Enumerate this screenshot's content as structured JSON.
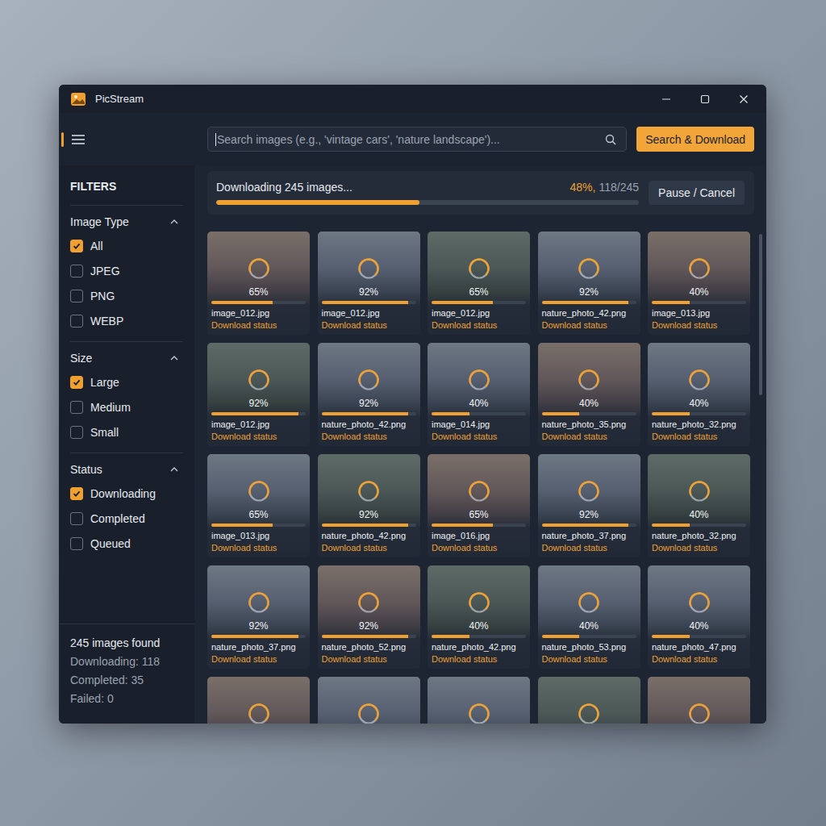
{
  "window": {
    "title": "PicStream"
  },
  "toolbar": {
    "search": {
      "placeholder": "Search images (e.g., 'vintage cars', 'nature landscape')..."
    },
    "button": "Search & Download"
  },
  "sidebar": {
    "title": "FILTERS",
    "groups": [
      {
        "label": "Image Type",
        "expanded": true,
        "options": [
          {
            "label": "All",
            "checked": true
          },
          {
            "label": "JPEG",
            "checked": false
          },
          {
            "label": "PNG",
            "checked": false
          },
          {
            "label": "WEBP",
            "checked": false
          }
        ]
      },
      {
        "label": "Size",
        "expanded": true,
        "options": [
          {
            "label": "Large",
            "checked": true
          },
          {
            "label": "Medium",
            "checked": false
          },
          {
            "label": "Small",
            "checked": false
          }
        ]
      },
      {
        "label": "Status",
        "expanded": true,
        "options": [
          {
            "label": "Downloading",
            "checked": true
          },
          {
            "label": "Completed",
            "checked": false
          },
          {
            "label": "Queued",
            "checked": false
          }
        ]
      }
    ],
    "summary": {
      "found": "245 images found",
      "lines": [
        "Downloading: 118",
        "Completed: 35",
        "Failed: 0"
      ]
    }
  },
  "progress": {
    "title": "Downloading 245 images...",
    "percent": "48%,",
    "count": "118/245",
    "level": 0.48,
    "button": "Pause / Cancel"
  },
  "cards": [
    {
      "kind": "full",
      "name": "image_012.jpg",
      "percent": "65%",
      "level": 0.65,
      "status": "Download status"
    },
    {
      "kind": "full",
      "name": "image_012.jpg",
      "percent": "92%",
      "level": 0.92,
      "status": "Download status"
    },
    {
      "kind": "full",
      "name": "image_012.jpg",
      "percent": "65%",
      "level": 0.65,
      "status": "Download status"
    },
    {
      "kind": "full",
      "name": "nature_photo_42.png",
      "percent": "92%",
      "level": 0.92,
      "status": "Download status"
    },
    {
      "kind": "full",
      "name": "image_013.jpg",
      "percent": "40%",
      "level": 0.4,
      "status": "Download status"
    },
    {
      "kind": "full",
      "name": "image_012.jpg",
      "percent": "92%",
      "level": 0.92,
      "status": "Download status"
    },
    {
      "kind": "full",
      "name": "nature_photo_42.png",
      "percent": "92%",
      "level": 0.92,
      "status": "Download status"
    },
    {
      "kind": "full",
      "name": "image_014.jpg",
      "percent": "40%",
      "level": 0.4,
      "status": "Download status"
    },
    {
      "kind": "full",
      "name": "nature_photo_35.png",
      "percent": "40%",
      "level": 0.4,
      "status": "Download status"
    },
    {
      "kind": "full",
      "name": "nature_photo_32.png",
      "percent": "40%",
      "level": 0.4,
      "status": "Download status"
    },
    {
      "kind": "full",
      "name": "image_013.jpg",
      "percent": "65%",
      "level": 0.65,
      "status": "Download status"
    },
    {
      "kind": "full",
      "name": "nature_photo_42.png",
      "percent": "92%",
      "level": 0.92,
      "status": "Download status"
    },
    {
      "kind": "full",
      "name": "image_016.jpg",
      "percent": "65%",
      "level": 0.65,
      "status": "Download status"
    },
    {
      "kind": "full",
      "name": "nature_photo_37.png",
      "percent": "92%",
      "level": 0.92,
      "status": "Download status"
    },
    {
      "kind": "full",
      "name": "nature_photo_32.png",
      "percent": "40%",
      "level": 0.4,
      "status": "Download status"
    },
    {
      "kind": "full",
      "name": "nature_photo_37.png",
      "percent": "92%",
      "level": 0.92,
      "status": "Download status"
    },
    {
      "kind": "full",
      "name": "nature_photo_52.png",
      "percent": "92%",
      "level": 0.92,
      "status": "Download status"
    },
    {
      "kind": "full",
      "name": "nature_photo_42.png",
      "percent": "40%",
      "level": 0.4,
      "status": "Download status"
    },
    {
      "kind": "full",
      "name": "nature_photo_53.png",
      "percent": "40%",
      "level": 0.4,
      "status": "Download status"
    },
    {
      "kind": "full",
      "name": "nature_photo_47.png",
      "percent": "40%",
      "level": 0.4,
      "status": "Download status"
    },
    {
      "kind": "partial"
    },
    {
      "kind": "partial"
    },
    {
      "kind": "partial"
    },
    {
      "kind": "partial"
    },
    {
      "kind": "partial"
    }
  ]
}
